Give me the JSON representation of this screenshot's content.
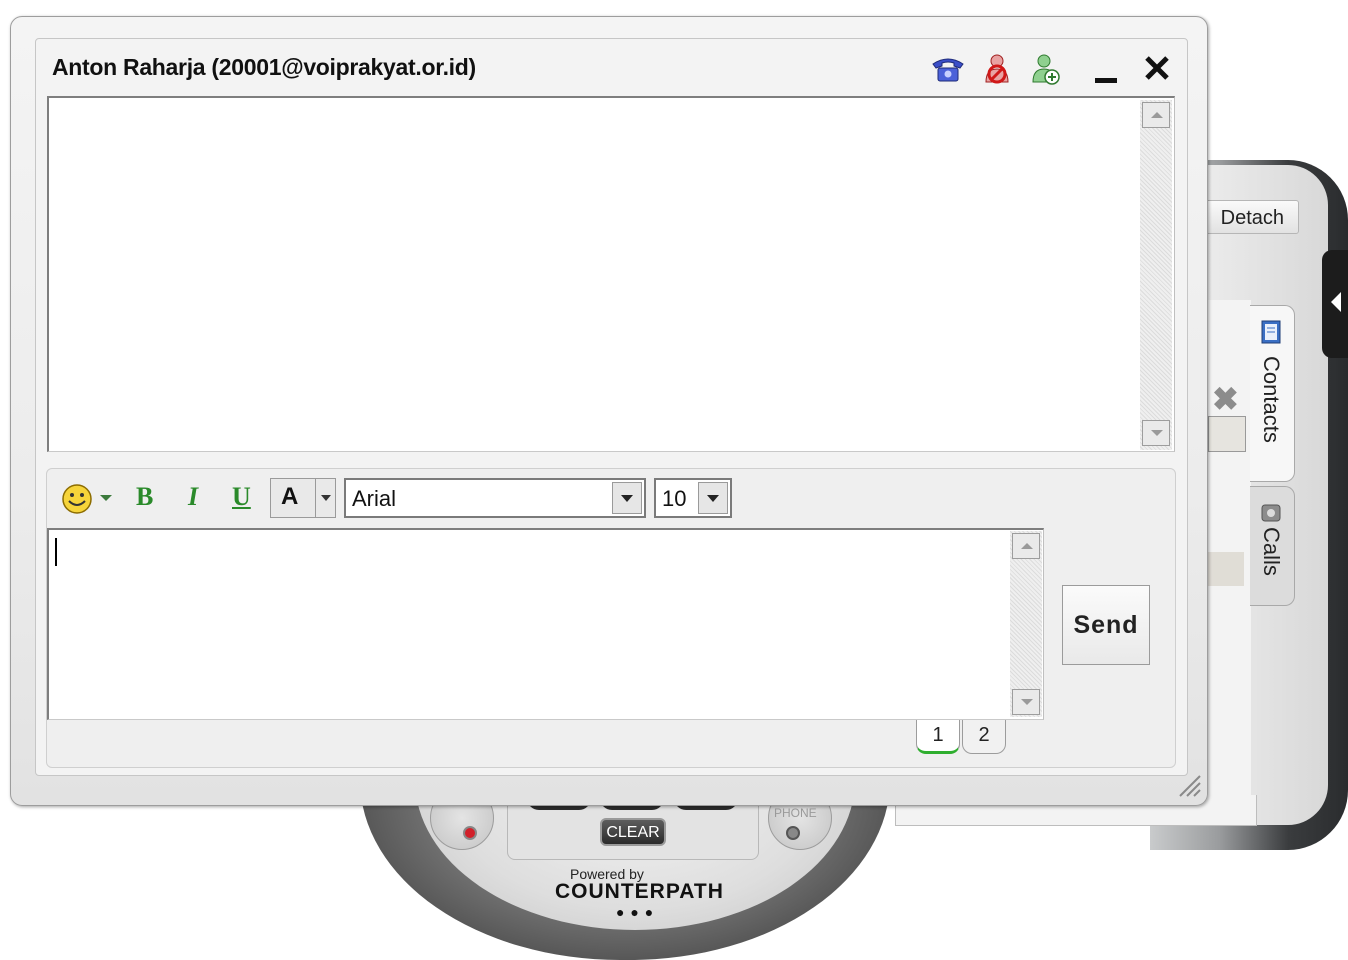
{
  "window": {
    "title": "Anton  Raharja (20001@voiprakyat.or.id)"
  },
  "title_icons": [
    "phone-icon",
    "block-contact-icon",
    "add-contact-icon",
    "minimize-icon",
    "close-icon"
  ],
  "format_toolbar": {
    "bold_label": "B",
    "italic_label": "I",
    "underline_label": "U",
    "color_label": "A",
    "font": "Arial",
    "size": "10"
  },
  "compose": {
    "send_label": "Send"
  },
  "page_tabs": [
    "1",
    "2"
  ],
  "background_phone": {
    "detach_label": "Detach",
    "tabs": [
      "Contacts",
      "Calls"
    ],
    "clear_label": "CLEAR",
    "phone_label": "PHONE",
    "powered_by": "Powered by",
    "brand": "COUNTERPATH"
  },
  "colors": {
    "format_green": "#2a8a2a",
    "active_tab_underline": "#2fae2f"
  }
}
